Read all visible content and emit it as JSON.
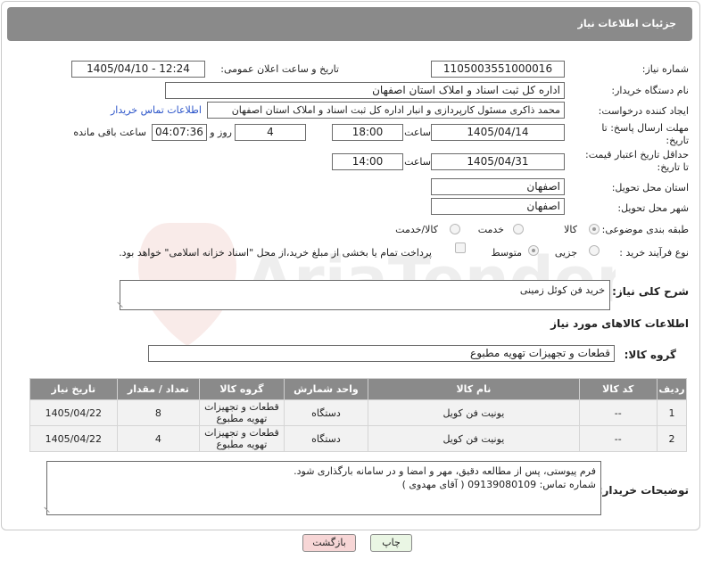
{
  "header": {
    "title": "جزئیات اطلاعات نیاز"
  },
  "watermark": {
    "text": "AriaTender.net"
  },
  "fields": {
    "need_number_label": "شماره نیاز:",
    "need_number": "1105003551000016",
    "announce_label": "تاریخ و ساعت اعلان عمومی:",
    "announce_value": "1405/04/10 - 12:24",
    "buyer_org_label": "نام دستگاه خریدار:",
    "buyer_org": "اداره کل ثبت اسناد و املاک استان اصفهان",
    "creator_label": "ایجاد کننده درخواست:",
    "creator": "محمد ذاکری مسئول کارپردازی و انبار اداره کل ثبت اسناد و املاک استان اصفهان",
    "contact_link": "اطلاعات تماس خریدار",
    "deadline_label_1": "مهلت ارسال پاسخ: تا",
    "deadline_label_2": "تاریخ:",
    "deadline_date": "1405/04/14",
    "time_label": "ساعت",
    "deadline_time": "18:00",
    "days": "4",
    "days_label": "روز و",
    "remaining": "04:07:36",
    "remaining_label": "ساعت باقی مانده",
    "validity_label_1": "حداقل تاریخ اعتبار قیمت:",
    "validity_label_2": "تا تاریخ:",
    "validity_date": "1405/04/31",
    "validity_time_label": "ساعت",
    "validity_time": "14:00",
    "province_label": "استان محل تحویل:",
    "province": "اصفهان",
    "city_label": "شهر محل تحویل:",
    "city": "اصفهان",
    "category_label": "طبقه بندی موضوعی:",
    "category_options": [
      "کالا",
      "خدمت",
      "کالا/خدمت"
    ],
    "process_label": "نوع فرآیند خرید :",
    "process_options": [
      "جزیی",
      "متوسط"
    ],
    "payment_note": "پرداخت تمام یا بخشی از مبلغ خرید،از محل \"اسناد خزانه اسلامی\" خواهد بود."
  },
  "description": {
    "label": "شرح کلی نیاز:",
    "value": "خرید فن کوئل زمینی"
  },
  "goods": {
    "section_title": "اطلاعات کالاهای مورد نیاز",
    "group_label": "گروه کالا:",
    "group_value": "قطعات و تجهیزات تهویه مطبوع",
    "columns": [
      "ردیف",
      "کد کالا",
      "نام کالا",
      "واحد شمارش",
      "گروه کالا",
      "تعداد / مقدار",
      "تاریخ نیاز"
    ],
    "rows": [
      {
        "row": "1",
        "code": "--",
        "name": "یونیت فن کویل",
        "unit": "دستگاه",
        "group": "قطعات و تجهیزات تهویه مطبوع",
        "qty": "8",
        "date": "1405/04/22"
      },
      {
        "row": "2",
        "code": "--",
        "name": "یونیت فن کویل",
        "unit": "دستگاه",
        "group": "قطعات و تجهیزات تهویه مطبوع",
        "qty": "4",
        "date": "1405/04/22"
      }
    ]
  },
  "buyer_notes": {
    "label": "توضیحات خریدار:",
    "line1": "فرم پیوستی، پس از مطالعه دقیق، مهر و امضا و در سامانه بارگذاری شود.",
    "line2": "شماره تماس: 09139080109 ( آقای مهدوی )"
  },
  "actions": {
    "print": "چاپ",
    "back": "بازگشت"
  },
  "colors": {
    "title_bar": "#8a8a8a",
    "link": "#2b54c9",
    "back_button": "#f7d6d6",
    "print_button": "#eaf6e4"
  }
}
